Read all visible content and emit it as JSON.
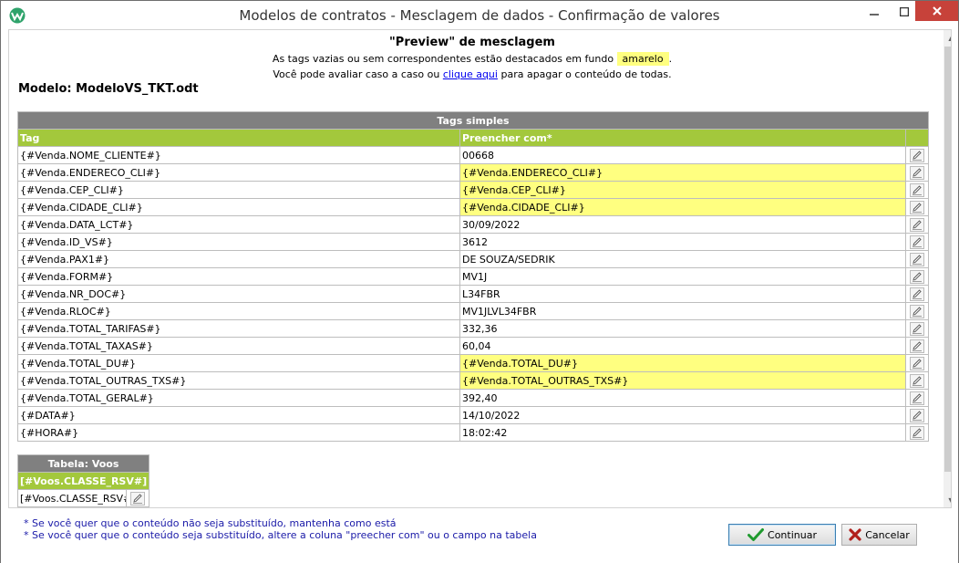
{
  "window": {
    "title": "Modelos de contratos - Mesclagem de dados - Confirmação de valores"
  },
  "preview": {
    "title": "\"Preview\" de mesclagem",
    "line1_before": "As tags vazias ou sem correspondentes estão destacados em fundo",
    "line1_highlight": "amarelo",
    "line1_after": ".",
    "line2_before": "Você pode avaliar caso a caso ou",
    "line2_link": "clique aqui",
    "line2_after": "para apagar o conteúdo de todas."
  },
  "modelo": "Modelo: ModeloVS_TKT.odt",
  "tags_table": {
    "section_title": "Tags simples",
    "col_tag": "Tag",
    "col_value": "Preencher com*",
    "rows": [
      {
        "tag": "{#Venda.NOME_CLIENTE#}",
        "value": "00668",
        "highlight": false
      },
      {
        "tag": "{#Venda.ENDERECO_CLI#}",
        "value": "{#Venda.ENDERECO_CLI#}",
        "highlight": true
      },
      {
        "tag": "{#Venda.CEP_CLI#}",
        "value": "{#Venda.CEP_CLI#}",
        "highlight": true
      },
      {
        "tag": "{#Venda.CIDADE_CLI#}",
        "value": "{#Venda.CIDADE_CLI#}",
        "highlight": true
      },
      {
        "tag": "{#Venda.DATA_LCT#}",
        "value": "30/09/2022",
        "highlight": false
      },
      {
        "tag": "{#Venda.ID_VS#}",
        "value": "3612",
        "highlight": false
      },
      {
        "tag": "{#Venda.PAX1#}",
        "value": "DE SOUZA/SEDRIK",
        "highlight": false
      },
      {
        "tag": "{#Venda.FORM#}",
        "value": "MV1J",
        "highlight": false
      },
      {
        "tag": "{#Venda.NR_DOC#}",
        "value": "L34FBR",
        "highlight": false
      },
      {
        "tag": "{#Venda.RLOC#}",
        "value": "MV1JLVL34FBR",
        "highlight": false
      },
      {
        "tag": "{#Venda.TOTAL_TARIFAS#}",
        "value": "332,36",
        "highlight": false
      },
      {
        "tag": "{#Venda.TOTAL_TAXAS#}",
        "value": "60,04",
        "highlight": false
      },
      {
        "tag": "{#Venda.TOTAL_DU#}",
        "value": "{#Venda.TOTAL_DU#}",
        "highlight": true
      },
      {
        "tag": "{#Venda.TOTAL_OUTRAS_TXS#}",
        "value": "{#Venda.TOTAL_OUTRAS_TXS#}",
        "highlight": true
      },
      {
        "tag": "{#Venda.TOTAL_GERAL#}",
        "value": "392,40",
        "highlight": false
      },
      {
        "tag": "{#DATA#}",
        "value": "14/10/2022",
        "highlight": false
      },
      {
        "tag": "{#HORA#}",
        "value": "18:02:42",
        "highlight": false
      }
    ]
  },
  "voos_table": {
    "title": "Tabela: Voos",
    "col_header": "[#Voos.CLASSE_RSV#]",
    "row_value": "[#Voos.CLASSE_RSV#]"
  },
  "footer": {
    "note1": "* Se você quer que o conteúdo não seja substituído, mantenha como está",
    "note2": "* Se você quer que o conteúdo seja substituído, altere a coluna \"preecher com\" ou o campo na tabela",
    "continuar_label": "Continuar",
    "cancelar_label": "Cancelar"
  },
  "colors": {
    "highlight": "#ffff80",
    "section_header": "#808080",
    "column_header": "#a3c83c",
    "close_button": "#c7423a"
  }
}
